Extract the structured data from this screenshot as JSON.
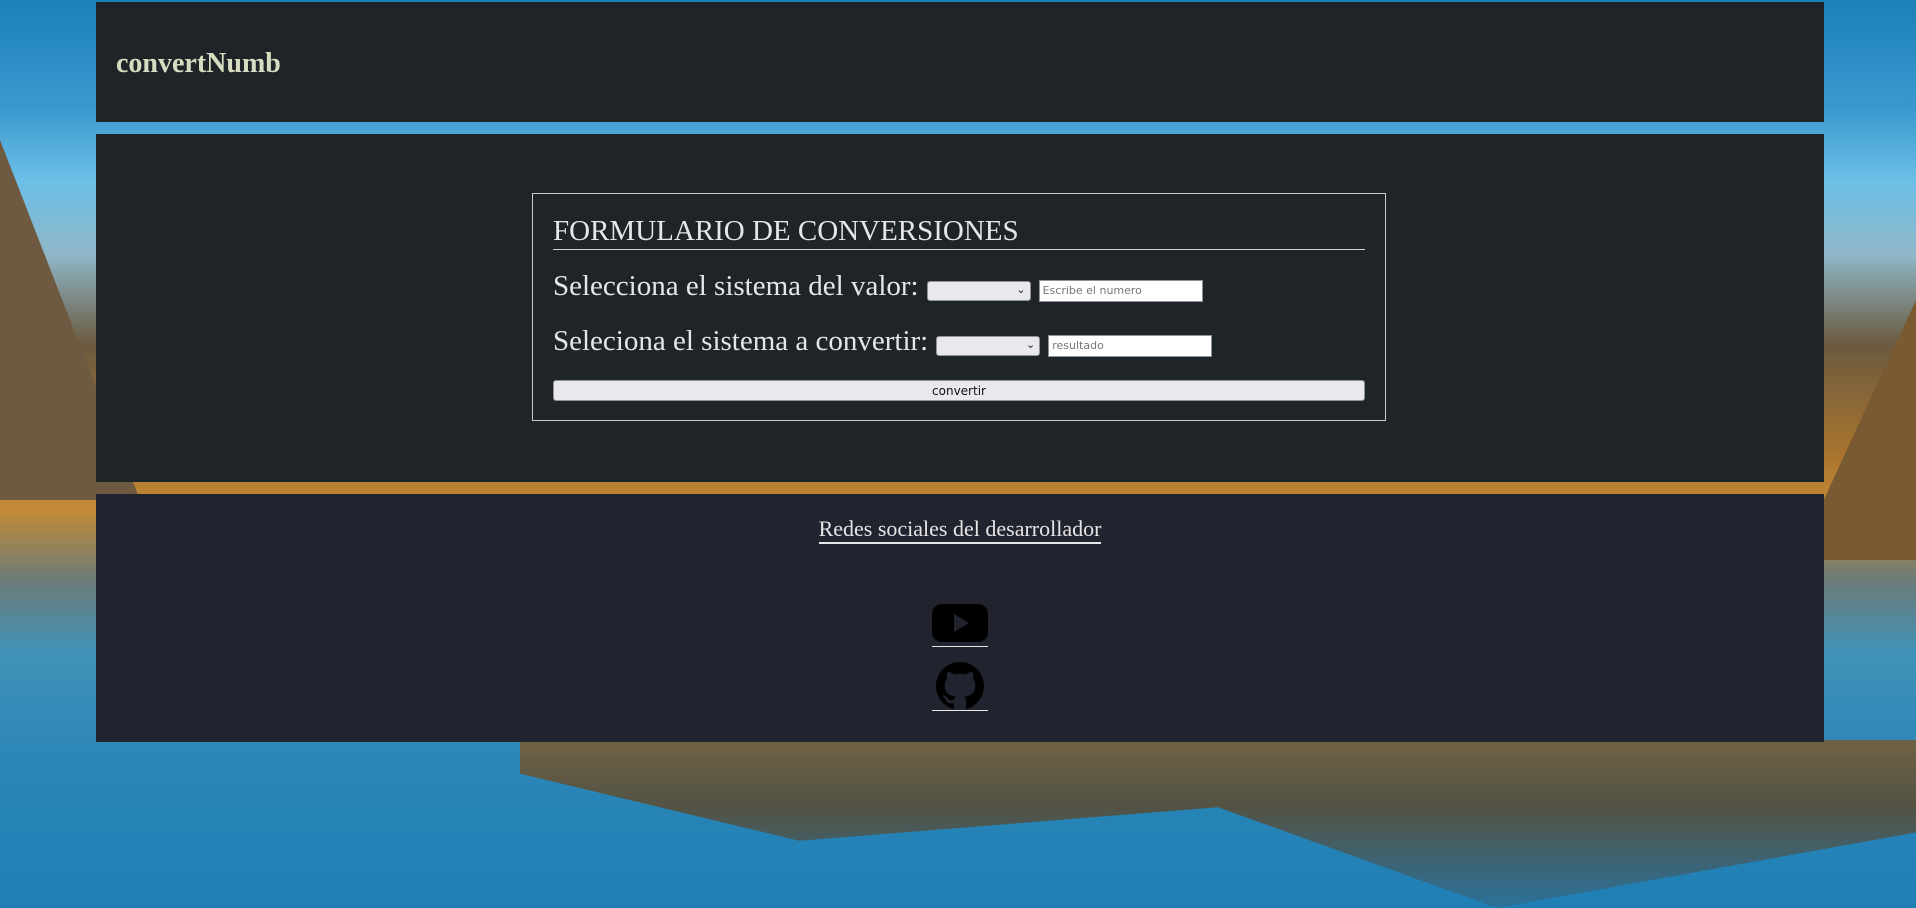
{
  "header": {
    "brand": "convertNumb"
  },
  "form": {
    "title": "FORMULARIO DE CONVERSIONES",
    "source_label": "Selecciona el sistema del valor:",
    "source_select_value": "",
    "number_placeholder": "Escribe el numero",
    "target_label": "Seleciona el sistema a convertir:",
    "target_select_value": "",
    "result_placeholder": "resultado",
    "submit_label": "convertir"
  },
  "footer": {
    "social_title": "Redes sociales del desarrollador",
    "links": [
      {
        "icon": "youtube-icon"
      },
      {
        "icon": "github-icon"
      }
    ]
  },
  "colors": {
    "panel": "#1f2428",
    "footer": "#21232f",
    "brand_text": "#d7dcc0",
    "text": "#e6e6e6"
  }
}
